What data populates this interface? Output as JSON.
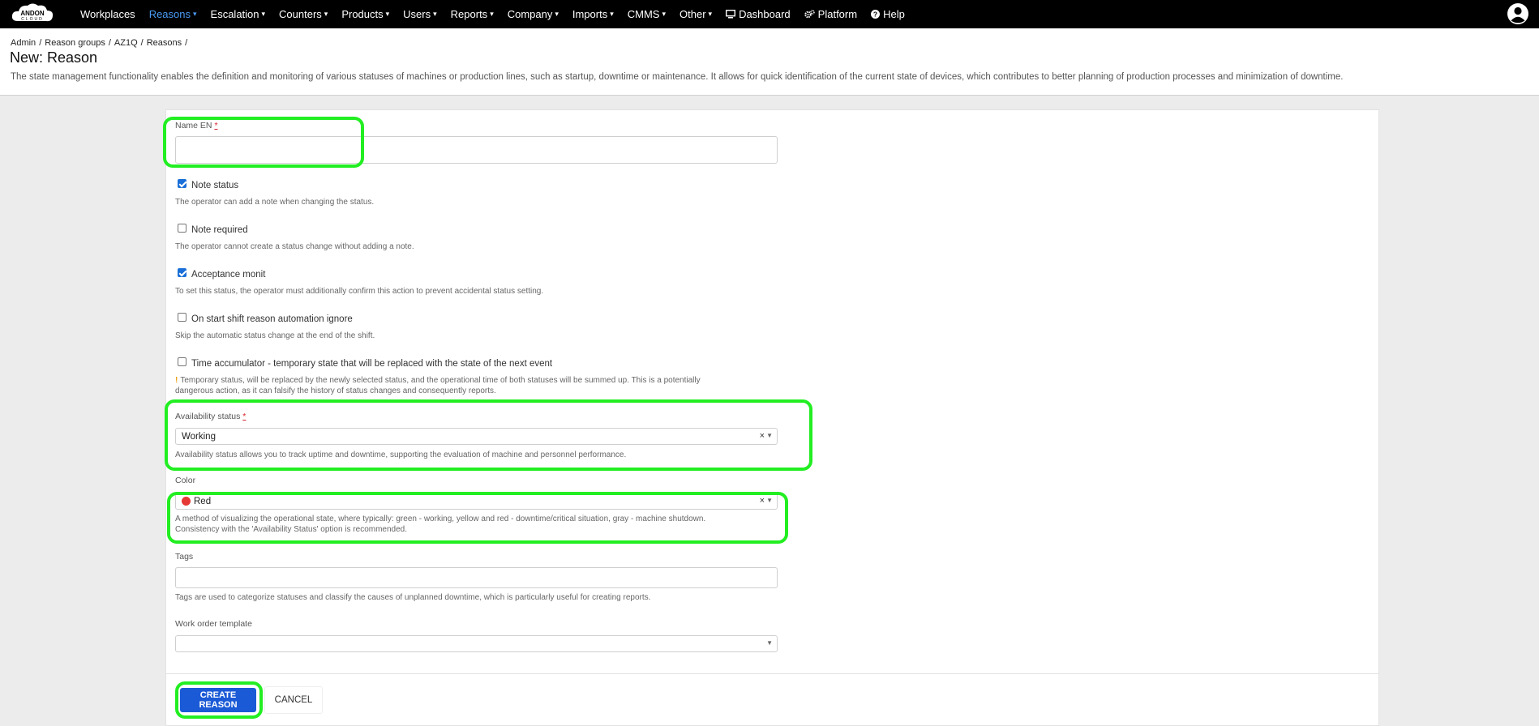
{
  "navbar": {
    "logo_text": "ANDON CLOUD",
    "items": [
      {
        "label": "Workplaces",
        "caret": false
      },
      {
        "label": "Reasons",
        "caret": true,
        "active": true
      },
      {
        "label": "Escalation",
        "caret": true
      },
      {
        "label": "Counters",
        "caret": true
      },
      {
        "label": "Products",
        "caret": true
      },
      {
        "label": "Users",
        "caret": true
      },
      {
        "label": "Reports",
        "caret": true
      },
      {
        "label": "Company",
        "caret": true
      },
      {
        "label": "Imports",
        "caret": true
      },
      {
        "label": "CMMS",
        "caret": true
      },
      {
        "label": "Other",
        "caret": true
      },
      {
        "label": "Dashboard",
        "icon": "monitor-icon"
      },
      {
        "label": "Platform",
        "icon": "cogs-icon"
      },
      {
        "label": "Help",
        "icon": "question-circle-icon"
      }
    ],
    "caret_glyph": "▾",
    "active_color": "#4a9af5"
  },
  "breadcrumb": [
    "Admin",
    "Reason groups",
    "AZ1Q",
    "Reasons"
  ],
  "breadcrumb_sep": "/",
  "page": {
    "title": "New: Reason",
    "description": "The state management functionality enables the definition and monitoring of various statuses of machines or production lines, such as startup, downtime or maintenance. It allows for quick identification of the current state of devices, which contributes to better planning of production processes and minimization of downtime."
  },
  "form": {
    "name_en": {
      "label": "Name EN",
      "required_mark": "*",
      "value": ""
    },
    "note_status": {
      "label": "Note status",
      "checked": true,
      "help": "The operator can add a note when changing the status."
    },
    "note_required": {
      "label": "Note required",
      "checked": false,
      "help": "The operator cannot create a status change without adding a note."
    },
    "acceptance_monit": {
      "label": "Acceptance monit",
      "checked": true,
      "help": "To set this status, the operator must additionally confirm this action to prevent accidental status setting."
    },
    "shift_ignore": {
      "label": "On start shift reason automation ignore",
      "checked": false,
      "help": "Skip the automatic status change at the end of the shift."
    },
    "time_accumulator": {
      "label": "Time accumulator - temporary state that will be replaced with the state of the next event",
      "checked": false,
      "warn": "!",
      "help_line1": "Temporary status, will be replaced by the newly selected status, and the operational time of both statuses will be summed up. This is a potentially",
      "help_line2": "dangerous action, as it can falsify the history of status changes and consequently reports."
    },
    "availability_status": {
      "label": "Availability status",
      "required_mark": "*",
      "value": "Working",
      "clear": "×",
      "arrow": "▼",
      "help": "Availability status allows you to track uptime and downtime, supporting the evaluation of machine and personnel performance."
    },
    "color": {
      "label": "Color",
      "value": "Red",
      "dot_color": "#e53935",
      "clear": "×",
      "arrow": "▼",
      "help_line1": "A method of visualizing the operational state, where typically: green - working, yellow and red - downtime/critical situation, gray - machine shutdown.",
      "help_line2": "Consistency with the 'Availability Status' option is recommended."
    },
    "tags": {
      "label": "Tags",
      "value": "",
      "help": "Tags are used to categorize statuses and classify the causes of unplanned downtime, which is particularly useful for creating reports."
    },
    "work_order_template": {
      "label": "Work order template",
      "value": "",
      "arrow": "▼"
    }
  },
  "actions": {
    "create_label": "CREATE REASON",
    "cancel_label": "CANCEL"
  },
  "highlight_color": "#22ee22"
}
